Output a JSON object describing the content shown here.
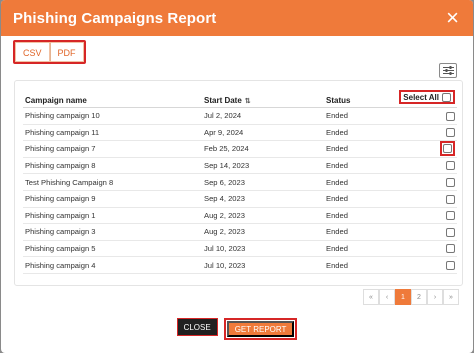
{
  "modal": {
    "title": "Phishing Campaigns Report",
    "close_glyph": "×"
  },
  "export": {
    "csv_label": "CSV",
    "pdf_label": "PDF"
  },
  "table": {
    "headers": {
      "campaign_name": "Campaign name",
      "start_date": "Start Date",
      "status": "Status",
      "select_all": "Select All"
    },
    "rows": [
      {
        "name": "Phishing campaign 10",
        "date": "Jul 2, 2024",
        "status": "Ended",
        "checked": false,
        "highlighted": false
      },
      {
        "name": "Phishing campaign 11",
        "date": "Apr 9, 2024",
        "status": "Ended",
        "checked": false,
        "highlighted": false
      },
      {
        "name": "Phishing campaign 7",
        "date": "Feb 25, 2024",
        "status": "Ended",
        "checked": false,
        "highlighted": true
      },
      {
        "name": "Phishing campaign 8",
        "date": "Sep 14, 2023",
        "status": "Ended",
        "checked": false,
        "highlighted": false
      },
      {
        "name": "Test Phishing Campaign 8",
        "date": "Sep 6, 2023",
        "status": "Ended",
        "checked": false,
        "highlighted": false
      },
      {
        "name": "Phishing campaign 9",
        "date": "Sep 4, 2023",
        "status": "Ended",
        "checked": false,
        "highlighted": false
      },
      {
        "name": "Phishing campaign 1",
        "date": "Aug 2, 2023",
        "status": "Ended",
        "checked": false,
        "highlighted": false
      },
      {
        "name": "Phishing campaign 3",
        "date": "Aug 2, 2023",
        "status": "Ended",
        "checked": false,
        "highlighted": false
      },
      {
        "name": "Phishing campaign 5",
        "date": "Jul 10, 2023",
        "status": "Ended",
        "checked": false,
        "highlighted": false
      },
      {
        "name": "Phishing campaign 4",
        "date": "Jul 10, 2023",
        "status": "Ended",
        "checked": false,
        "highlighted": false
      }
    ]
  },
  "pagination": {
    "first": "«",
    "prev": "‹",
    "pages": [
      "1",
      "2"
    ],
    "current": "1",
    "next": "›",
    "last": "»"
  },
  "footer": {
    "close_label": "CLOSE",
    "report_label": "GET REPORT"
  },
  "colors": {
    "accent": "#ef7a3a",
    "highlight": "#d62626"
  },
  "icons": {
    "filter": "filter-sliders-icon",
    "sort": "sort-icon",
    "close": "close-icon"
  }
}
